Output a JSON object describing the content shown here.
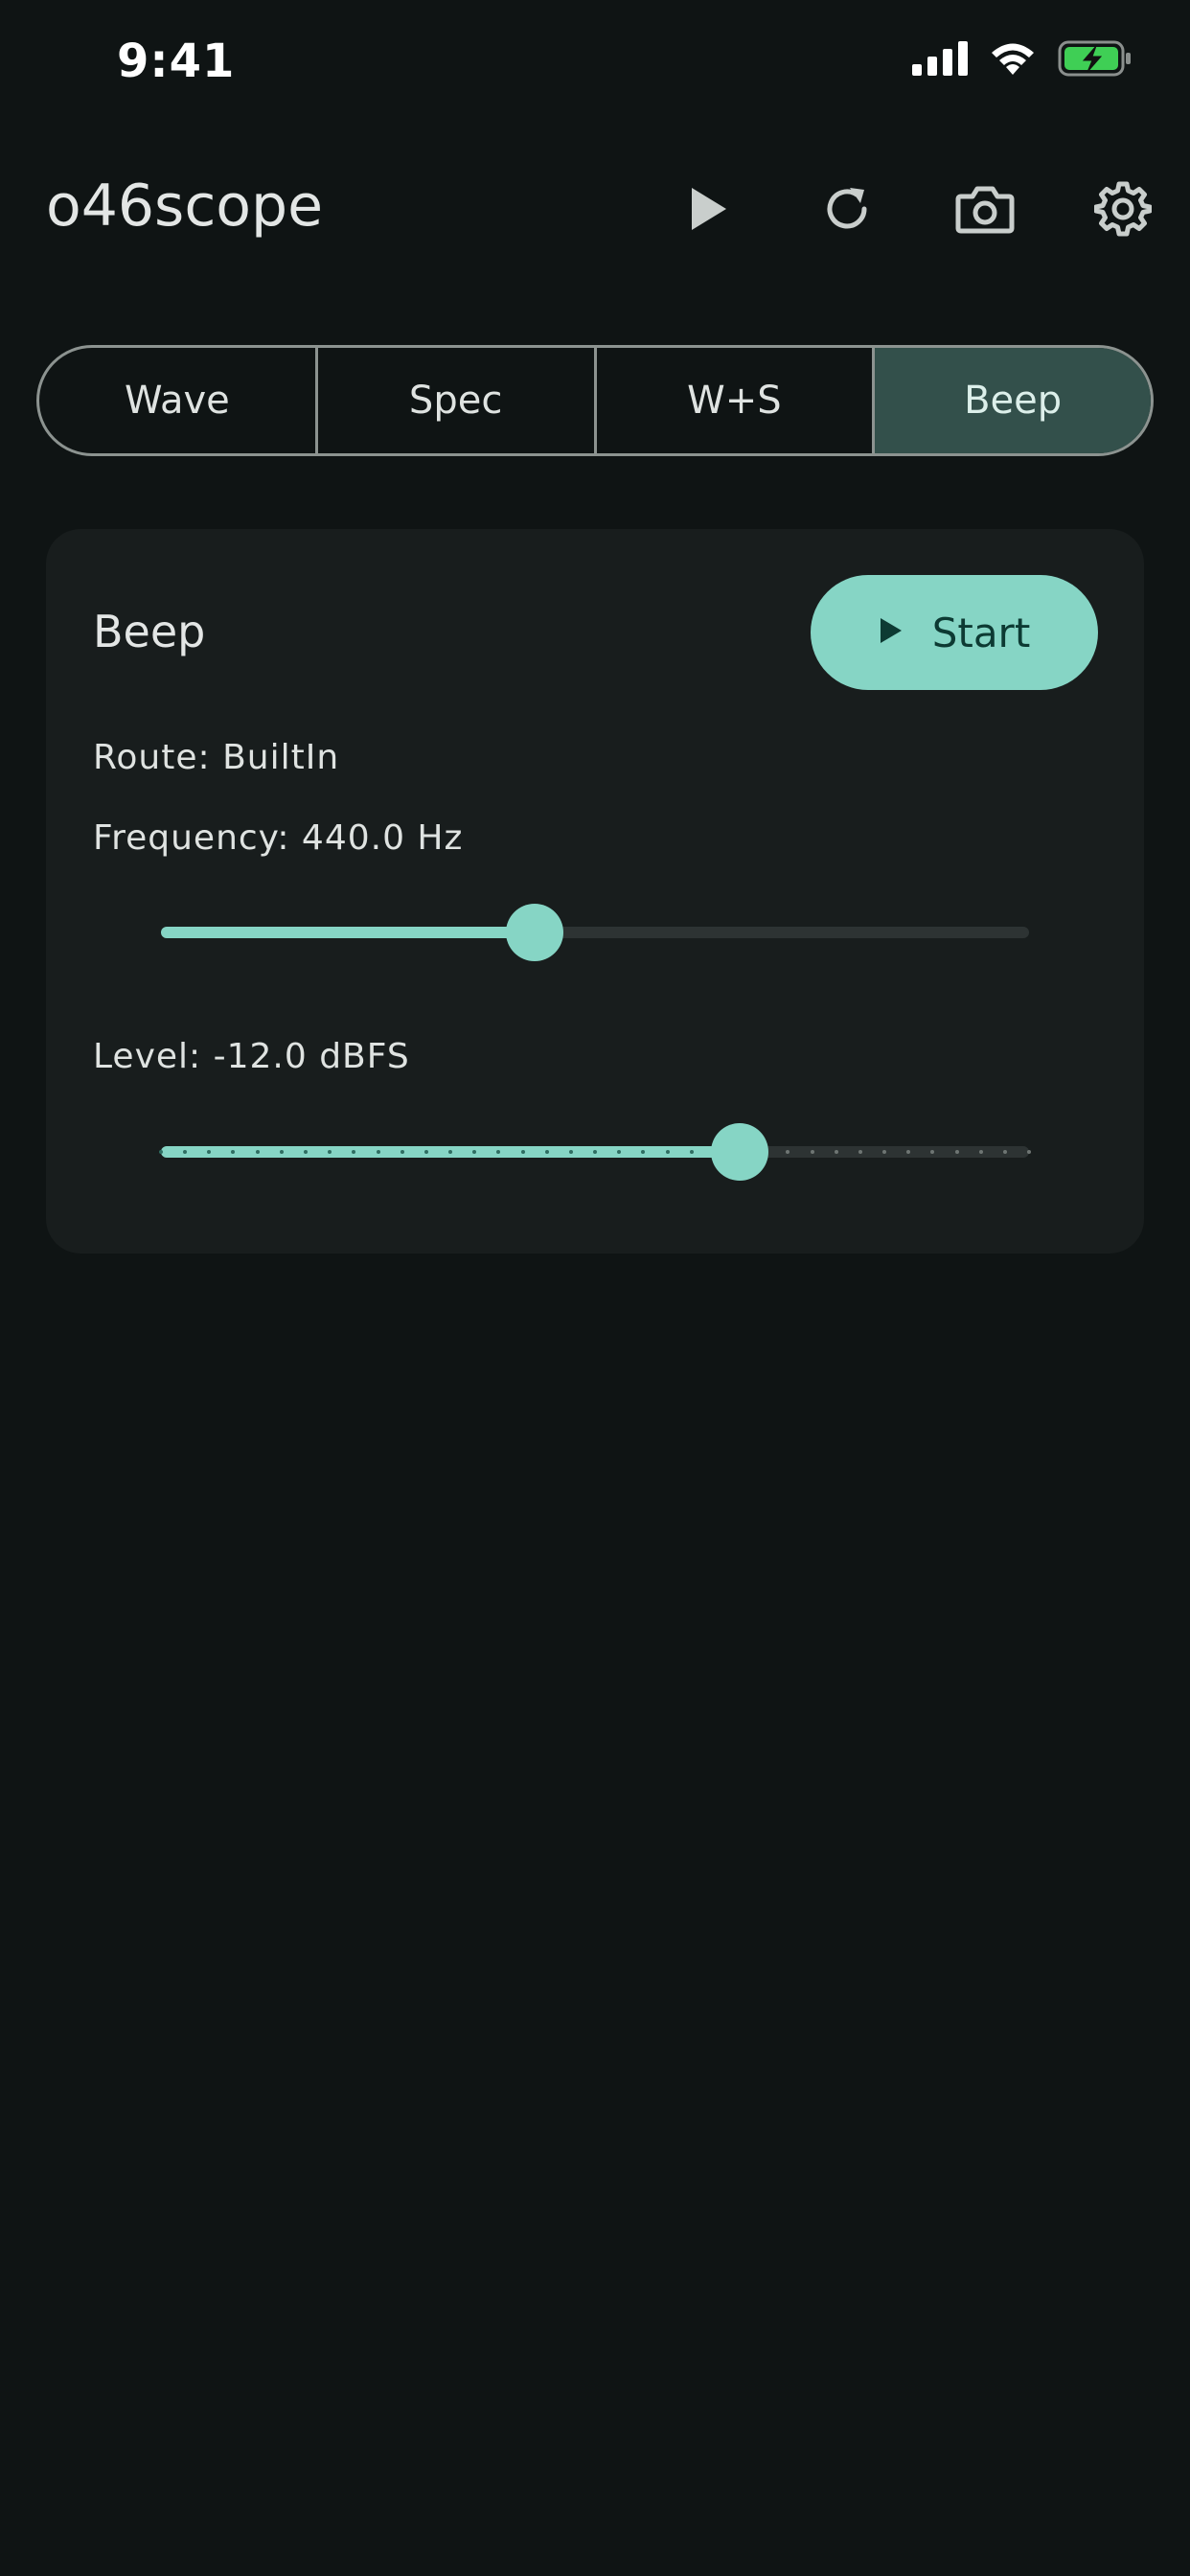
{
  "status_bar": {
    "time": "9:41"
  },
  "app_bar": {
    "title": "o46scope",
    "actions": [
      "play-icon",
      "refresh-icon",
      "camera-icon",
      "settings-icon"
    ]
  },
  "tabs": {
    "items": [
      "Wave",
      "Spec",
      "W+S",
      "Beep"
    ],
    "selected": "Beep"
  },
  "beep_card": {
    "title": "Beep",
    "start_label": "Start",
    "route": "Route: BuiltIn",
    "frequency_label": "Frequency: 440.0 Hz",
    "frequency_slider_fraction": 0.43,
    "level_label": "Level: -12.0 dBFS",
    "level_slider_fraction": 0.667,
    "level_slider_steps": 36
  },
  "colors": {
    "background": "#0f1414",
    "card": "#181d1d",
    "accent": "#86d5c5",
    "tab_selected": "#33504b",
    "battery_green": "#3fcf55"
  }
}
